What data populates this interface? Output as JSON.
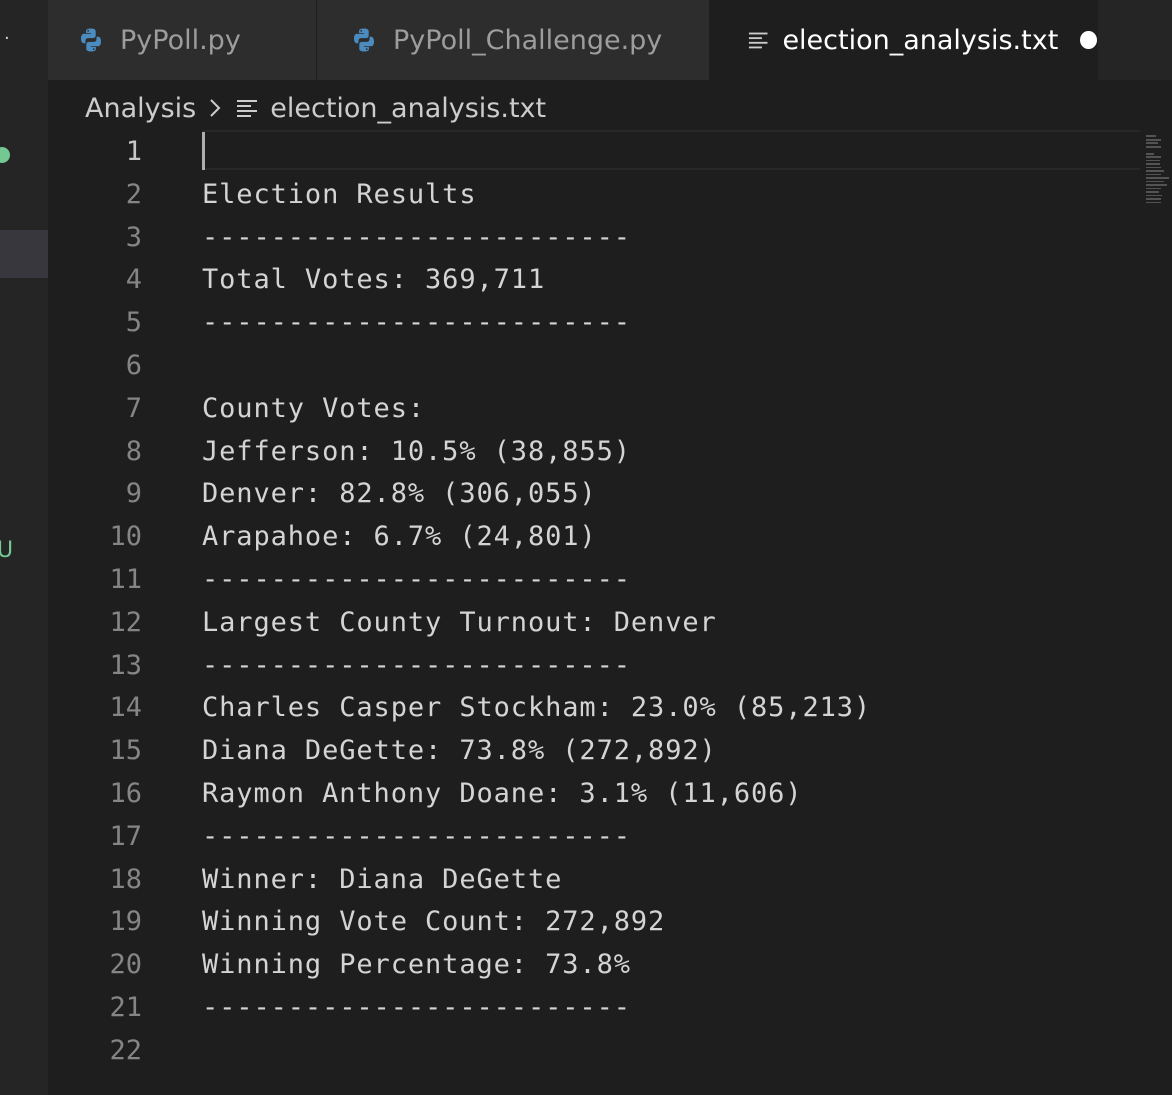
{
  "tabs": [
    {
      "label": "PyPoll.py",
      "icon": "python-icon"
    },
    {
      "label": "PyPoll_Challenge.py",
      "icon": "python-icon"
    },
    {
      "label": "election_analysis.txt",
      "icon": "text-file-icon",
      "active": true,
      "unsaved": true
    }
  ],
  "breadcrumb": {
    "folder": "Analysis",
    "file": "election_analysis.txt"
  },
  "sidebar": {
    "overflow_glyph": "·",
    "scm_badge": "U"
  },
  "editor": {
    "active_line": 1,
    "lines": [
      "",
      "Election Results",
      "-------------------------",
      "Total Votes: 369,711",
      "-------------------------",
      "",
      "County Votes:",
      "Jefferson: 10.5% (38,855)",
      "Denver: 82.8% (306,055)",
      "Arapahoe: 6.7% (24,801)",
      "-------------------------",
      "Largest County Turnout: Denver",
      "-------------------------",
      "Charles Casper Stockham: 23.0% (85,213)",
      "Diana DeGette: 73.8% (272,892)",
      "Raymon Anthony Doane: 3.1% (11,606)",
      "-------------------------",
      "Winner: Diana DeGette",
      "Winning Vote Count: 272,892",
      "Winning Percentage: 73.8%",
      "-------------------------",
      ""
    ],
    "line_numbers": [
      "1",
      "2",
      "3",
      "4",
      "5",
      "6",
      "7",
      "8",
      "9",
      "10",
      "11",
      "12",
      "13",
      "14",
      "15",
      "16",
      "17",
      "18",
      "19",
      "20",
      "21",
      "22"
    ]
  },
  "colors": {
    "editor_bg": "#1e1e1e",
    "tab_bg": "#2d2d2d",
    "python_blue": "#4b8bbe",
    "python_yellow": "#ffd43b",
    "scm_green": "#73c991"
  }
}
